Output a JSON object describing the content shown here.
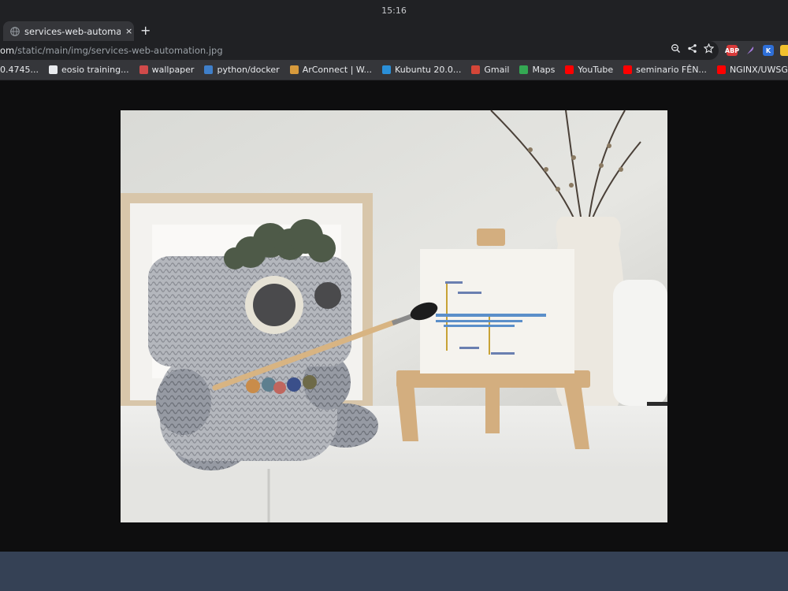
{
  "clock": "15:16",
  "tab": {
    "title": "services-web-automation.jpg",
    "close": "×",
    "new": "+"
  },
  "address": {
    "domain": "om",
    "path": "/static/main/img/services-web-automation.jpg"
  },
  "bookmarks": [
    {
      "label": "0.4745...",
      "color": "#888888"
    },
    {
      "label": "eosio training...",
      "color": "#e8eaed"
    },
    {
      "label": "wallpaper",
      "color": "#d04a4a"
    },
    {
      "label": "python/docker",
      "color": "#3f7fc9"
    },
    {
      "label": "ArConnect | W...",
      "color": "#d79a3c"
    },
    {
      "label": "Kubuntu 20.0...",
      "color": "#2a8fd8"
    },
    {
      "label": "Gmail",
      "color": "#d44638"
    },
    {
      "label": "Maps",
      "color": "#34a853"
    },
    {
      "label": "YouTube",
      "color": "#ff0000"
    },
    {
      "label": "seminario FÊN...",
      "color": "#ff0000"
    },
    {
      "label": "NGINX/UWSGI...",
      "color": "#ff0000"
    }
  ],
  "extensions": [
    "ABP",
    "",
    "K",
    ""
  ],
  "colors": {
    "statusbar": "#354155",
    "chrome": "#35363a",
    "titlebar": "#202124"
  }
}
